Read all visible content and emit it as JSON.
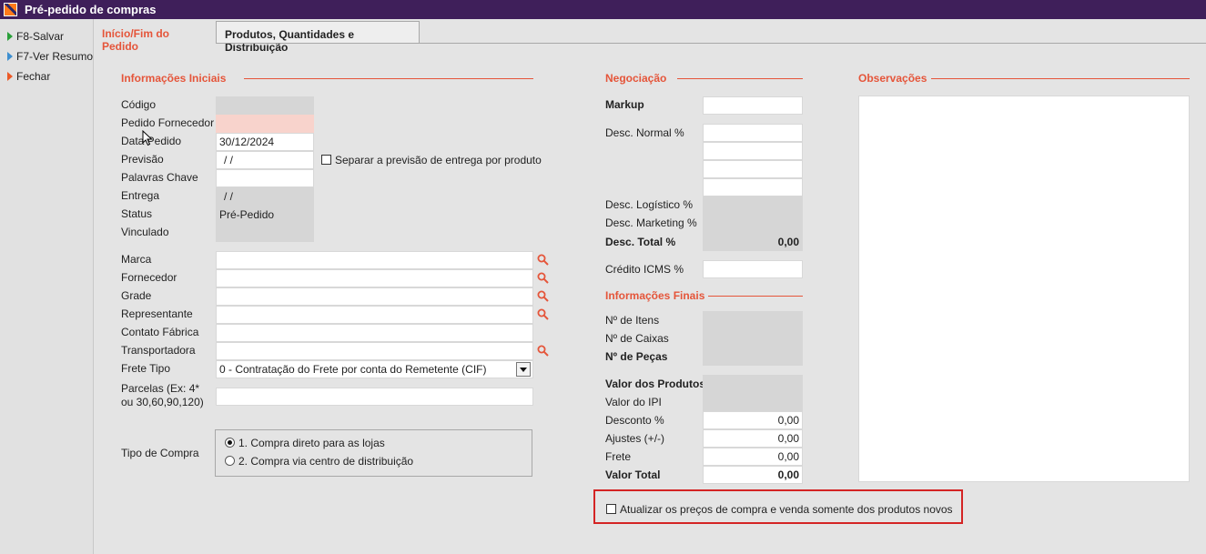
{
  "window": {
    "title": "Pré-pedido de compras"
  },
  "sidebar": {
    "items": [
      {
        "label": "F8-Salvar",
        "icon": "green-arrow-icon"
      },
      {
        "label": "F7-Ver Resumo",
        "icon": "blue-arrow-icon"
      },
      {
        "label": "Fechar",
        "icon": "orange-arrow-icon"
      }
    ]
  },
  "tabs": [
    {
      "label": "Início/Fim do Pedido",
      "active": true
    },
    {
      "label": "Produtos, Quantidades e Distribuição",
      "active": false
    }
  ],
  "informacoes_iniciais": {
    "title": "Informações Iniciais",
    "codigo": {
      "label": "Código",
      "value": ""
    },
    "pedido_fornecedor": {
      "label": "Pedido Fornecedor",
      "value": ""
    },
    "data_pedido": {
      "label": "Data Pedido",
      "value": "30/12/2024"
    },
    "previsao": {
      "label": "Previsão",
      "value": " /  /"
    },
    "separar_previsao": {
      "label": "Separar a previsão de entrega por produto",
      "checked": false
    },
    "palavras_chave": {
      "label": "Palavras Chave",
      "value": ""
    },
    "entrega": {
      "label": "Entrega",
      "value": " /  /"
    },
    "status": {
      "label": "Status",
      "value": "Pré-Pedido"
    },
    "vinculado": {
      "label": "Vinculado",
      "value": ""
    }
  },
  "lookups": {
    "marca": {
      "label": "Marca",
      "value": ""
    },
    "fornecedor": {
      "label": "Fornecedor",
      "value": ""
    },
    "grade": {
      "label": "Grade",
      "value": ""
    },
    "representante": {
      "label": "Representante",
      "value": ""
    },
    "contato_fabrica": {
      "label": "Contato Fábrica",
      "value": ""
    },
    "transportadora": {
      "label": "Transportadora",
      "value": ""
    },
    "frete_tipo": {
      "label": "Frete Tipo",
      "value": "0 - Contratação do Frete por conta do Remetente (CIF)"
    },
    "parcelas": {
      "label_line1": "Parcelas (Ex: 4*",
      "label_line2": "ou 30,60,90,120)",
      "value": ""
    }
  },
  "tipo_compra": {
    "label": "Tipo de Compra",
    "options": [
      {
        "label": "1. Compra direto para as lojas",
        "selected": true
      },
      {
        "label": "2. Compra via centro de distribuição",
        "selected": false
      }
    ]
  },
  "negociacao": {
    "title": "Negociação",
    "markup": {
      "label": "Markup",
      "value": ""
    },
    "desc_normal": {
      "label": "Desc. Normal %",
      "values": [
        "",
        "",
        "",
        ""
      ]
    },
    "desc_logistico": {
      "label": "Desc. Logístico %",
      "value": ""
    },
    "desc_marketing": {
      "label": "Desc. Marketing %",
      "value": ""
    },
    "desc_total": {
      "label": "Desc. Total %",
      "value": "0,00"
    },
    "credito_icms": {
      "label": "Crédito ICMS %",
      "value": ""
    }
  },
  "informacoes_finais": {
    "title": "Informações Finais",
    "n_itens": {
      "label": "Nº de Itens",
      "value": ""
    },
    "n_caixas": {
      "label": "Nº de Caixas",
      "value": ""
    },
    "n_pecas": {
      "label": "Nº de Peças",
      "value": ""
    },
    "valor_produtos": {
      "label": "Valor dos Produtos",
      "value": ""
    },
    "valor_ipi": {
      "label": "Valor do IPI",
      "value": ""
    },
    "desconto": {
      "label": "Desconto %",
      "value": "0,00"
    },
    "ajustes": {
      "label": "Ajustes (+/-)",
      "value": "0,00"
    },
    "frete": {
      "label": "Frete",
      "value": "0,00"
    },
    "valor_total": {
      "label": "Valor Total",
      "value": "0,00"
    }
  },
  "observacoes": {
    "title": "Observações",
    "value": ""
  },
  "atualizar_precos": {
    "label": "Atualizar os preços de compra e venda somente dos produtos novos",
    "checked": false
  },
  "colors": {
    "titlebar": "#3f1f5a",
    "accent": "#e5553a",
    "highlight_box": "#d42424",
    "readonly": "#d6d6d6",
    "required": "#f8d3cc"
  }
}
